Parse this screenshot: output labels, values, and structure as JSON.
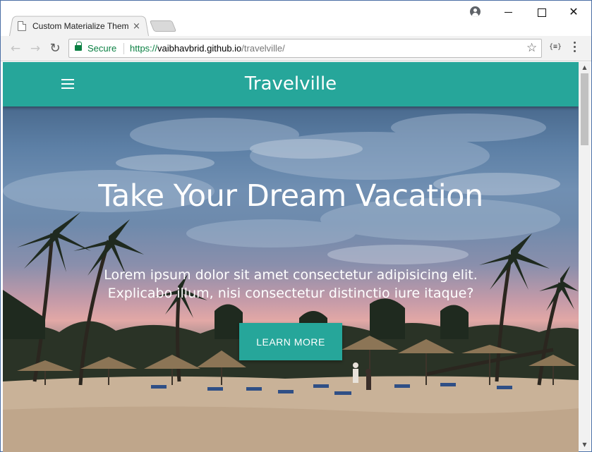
{
  "browser": {
    "tab": {
      "title": "Custom Materialize Them",
      "close_glyph": "×"
    },
    "icons": {
      "favicon": "page-icon",
      "new_tab": "new-tab-icon",
      "profile": "profile-icon",
      "back": "back-arrow-icon",
      "forward": "forward-arrow-icon",
      "reload": "reload-icon",
      "lock": "lock-icon",
      "bookmark": "star-icon",
      "extension": "extension-icon",
      "menu": "kebab-menu-icon"
    },
    "window_controls": {
      "close_glyph": "✕"
    },
    "omnibox": {
      "secure_label": "Secure",
      "url_scheme": "https://",
      "url_host": "vaibhavbrid.github.io",
      "url_path": "/travelville/",
      "extension_label": "{≡}"
    },
    "nav_glyphs": {
      "back": "←",
      "forward": "→",
      "reload": "↻",
      "star": "☆"
    },
    "scroll_glyphs": {
      "up": "▲",
      "down": "▼"
    }
  },
  "site": {
    "brand": "Travelville",
    "colors": {
      "primary": "#26a69a",
      "text": "#ffffff"
    },
    "hero": {
      "title": "Take Your Dream Vacation",
      "subtitle": "Lorem ipsum dolor sit amet consectetur adipisicing elit. Explicabo illum, nisi consectetur distinctio iure itaque?",
      "cta_label": "Learn More"
    }
  }
}
